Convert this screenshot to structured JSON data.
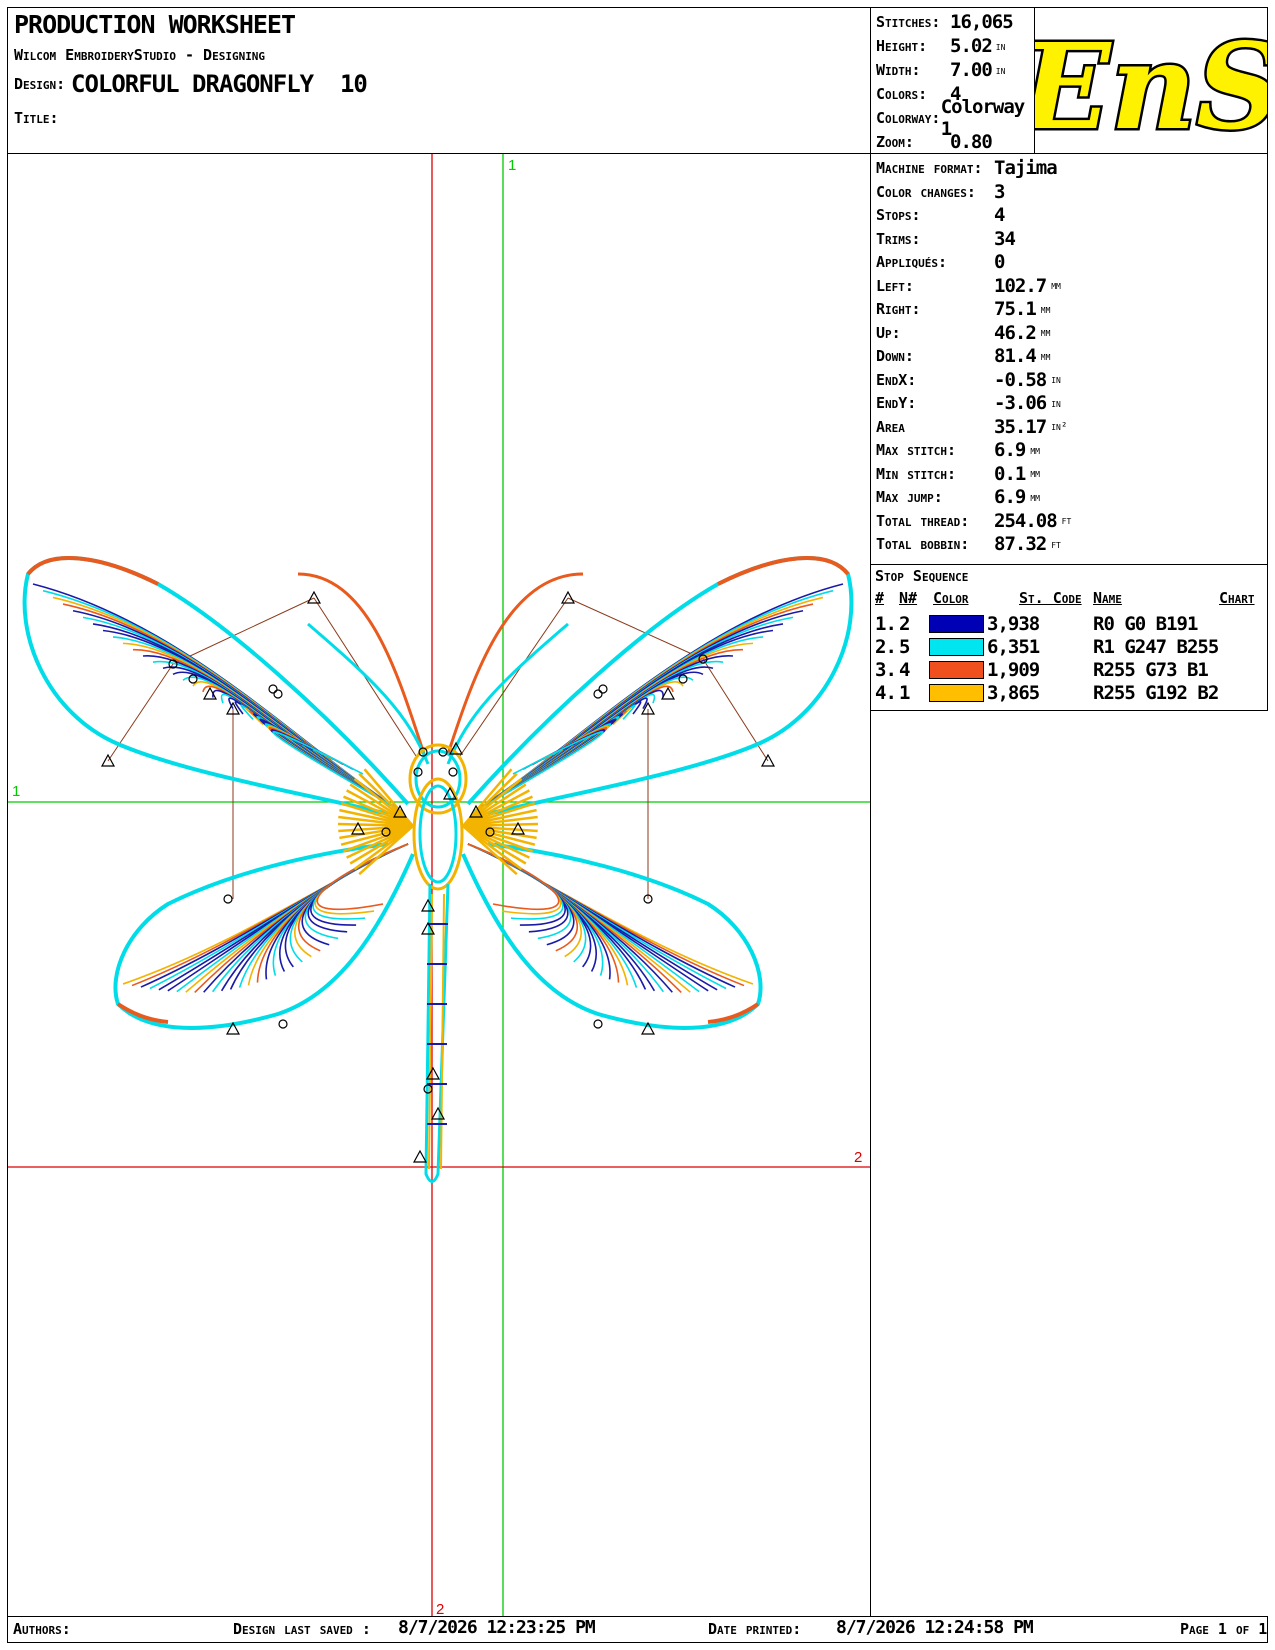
{
  "header": {
    "title": "PRODUCTION WORKSHEET",
    "software": "Wilcom EmbroideryStudio - Designing",
    "design_label": "Design:",
    "design_name": "COLORFUL DRAGONFLY  10",
    "title_label": "Title:"
  },
  "summary": [
    {
      "label": "Stitches:",
      "value": "16,065",
      "unit": ""
    },
    {
      "label": "Height:",
      "value": "5.02",
      "unit": "in"
    },
    {
      "label": "Width:",
      "value": "7.00",
      "unit": "in"
    },
    {
      "label": "Colors:",
      "value": "4",
      "unit": ""
    },
    {
      "label": "Colorway:",
      "value": "Colorway 1",
      "unit": ""
    },
    {
      "label": "Zoom:",
      "value": "0.80",
      "unit": ""
    }
  ],
  "logo": {
    "text": "EnS",
    "fill": "#FFF200",
    "stroke": "#000000"
  },
  "details": [
    {
      "label": "Machine format:",
      "value": "Tajima",
      "unit": ""
    },
    {
      "label": "Color changes:",
      "value": "3",
      "unit": ""
    },
    {
      "label": "Stops:",
      "value": "4",
      "unit": ""
    },
    {
      "label": "Trims:",
      "value": "34",
      "unit": ""
    },
    {
      "label": "Appliqués:",
      "value": "0",
      "unit": ""
    },
    {
      "label": "Left:",
      "value": "102.7",
      "unit": "mm"
    },
    {
      "label": "Right:",
      "value": "75.1",
      "unit": "mm"
    },
    {
      "label": "Up:",
      "value": "46.2",
      "unit": "mm"
    },
    {
      "label": "Down:",
      "value": "81.4",
      "unit": "mm"
    },
    {
      "label": "EndX:",
      "value": "-0.58",
      "unit": "in"
    },
    {
      "label": "EndY:",
      "value": "-3.06",
      "unit": "in"
    },
    {
      "label": "Area",
      "value": "35.17",
      "unit": "in²"
    },
    {
      "label": "Max stitch:",
      "value": "6.9",
      "unit": "mm"
    },
    {
      "label": "Min stitch:",
      "value": "0.1",
      "unit": "mm"
    },
    {
      "label": "Max jump:",
      "value": "6.9",
      "unit": "mm"
    },
    {
      "label": "Total thread:",
      "value": "254.08",
      "unit": "ft"
    },
    {
      "label": "Total bobbin:",
      "value": "87.32",
      "unit": "ft"
    }
  ],
  "stop_sequence": {
    "title": "Stop Sequence",
    "headers": {
      "num": "#",
      "n": "N#",
      "color": "Color",
      "code": "St. Code",
      "name": "Name",
      "chart": "Chart"
    },
    "rows": [
      {
        "num": "1.",
        "n": "2",
        "color": "#0000B4",
        "code": "3,938",
        "name": "R0 G0 B191"
      },
      {
        "num": "2.",
        "n": "5",
        "color": "#00E5F0",
        "code": "6,351",
        "name": "R1 G247 B255"
      },
      {
        "num": "3.",
        "n": "4",
        "color": "#F0501E",
        "code": "1,909",
        "name": "R255 G73 B1"
      },
      {
        "num": "4.",
        "n": "1",
        "color": "#FFBF00",
        "code": "3,865",
        "name": "R255 G192 B2"
      }
    ]
  },
  "canvas": {
    "guide_label_1": "1",
    "guide_label_2": "2",
    "colors": {
      "navy": "#1a1aa8",
      "cyan": "#00dde8",
      "orange": "#e85a1e",
      "gold": "#f2b400",
      "guide_green": "#00cc00",
      "guide_red": "#dd0000"
    }
  },
  "footer": {
    "authors_label": "Authors:",
    "saved_label": "Design last saved :",
    "saved_value": "8/7/2026 12:23:25 PM",
    "printed_label": "Date printed:",
    "printed_value": "8/7/2026 12:24:58 PM",
    "page_label": "Page 1 of 1"
  }
}
